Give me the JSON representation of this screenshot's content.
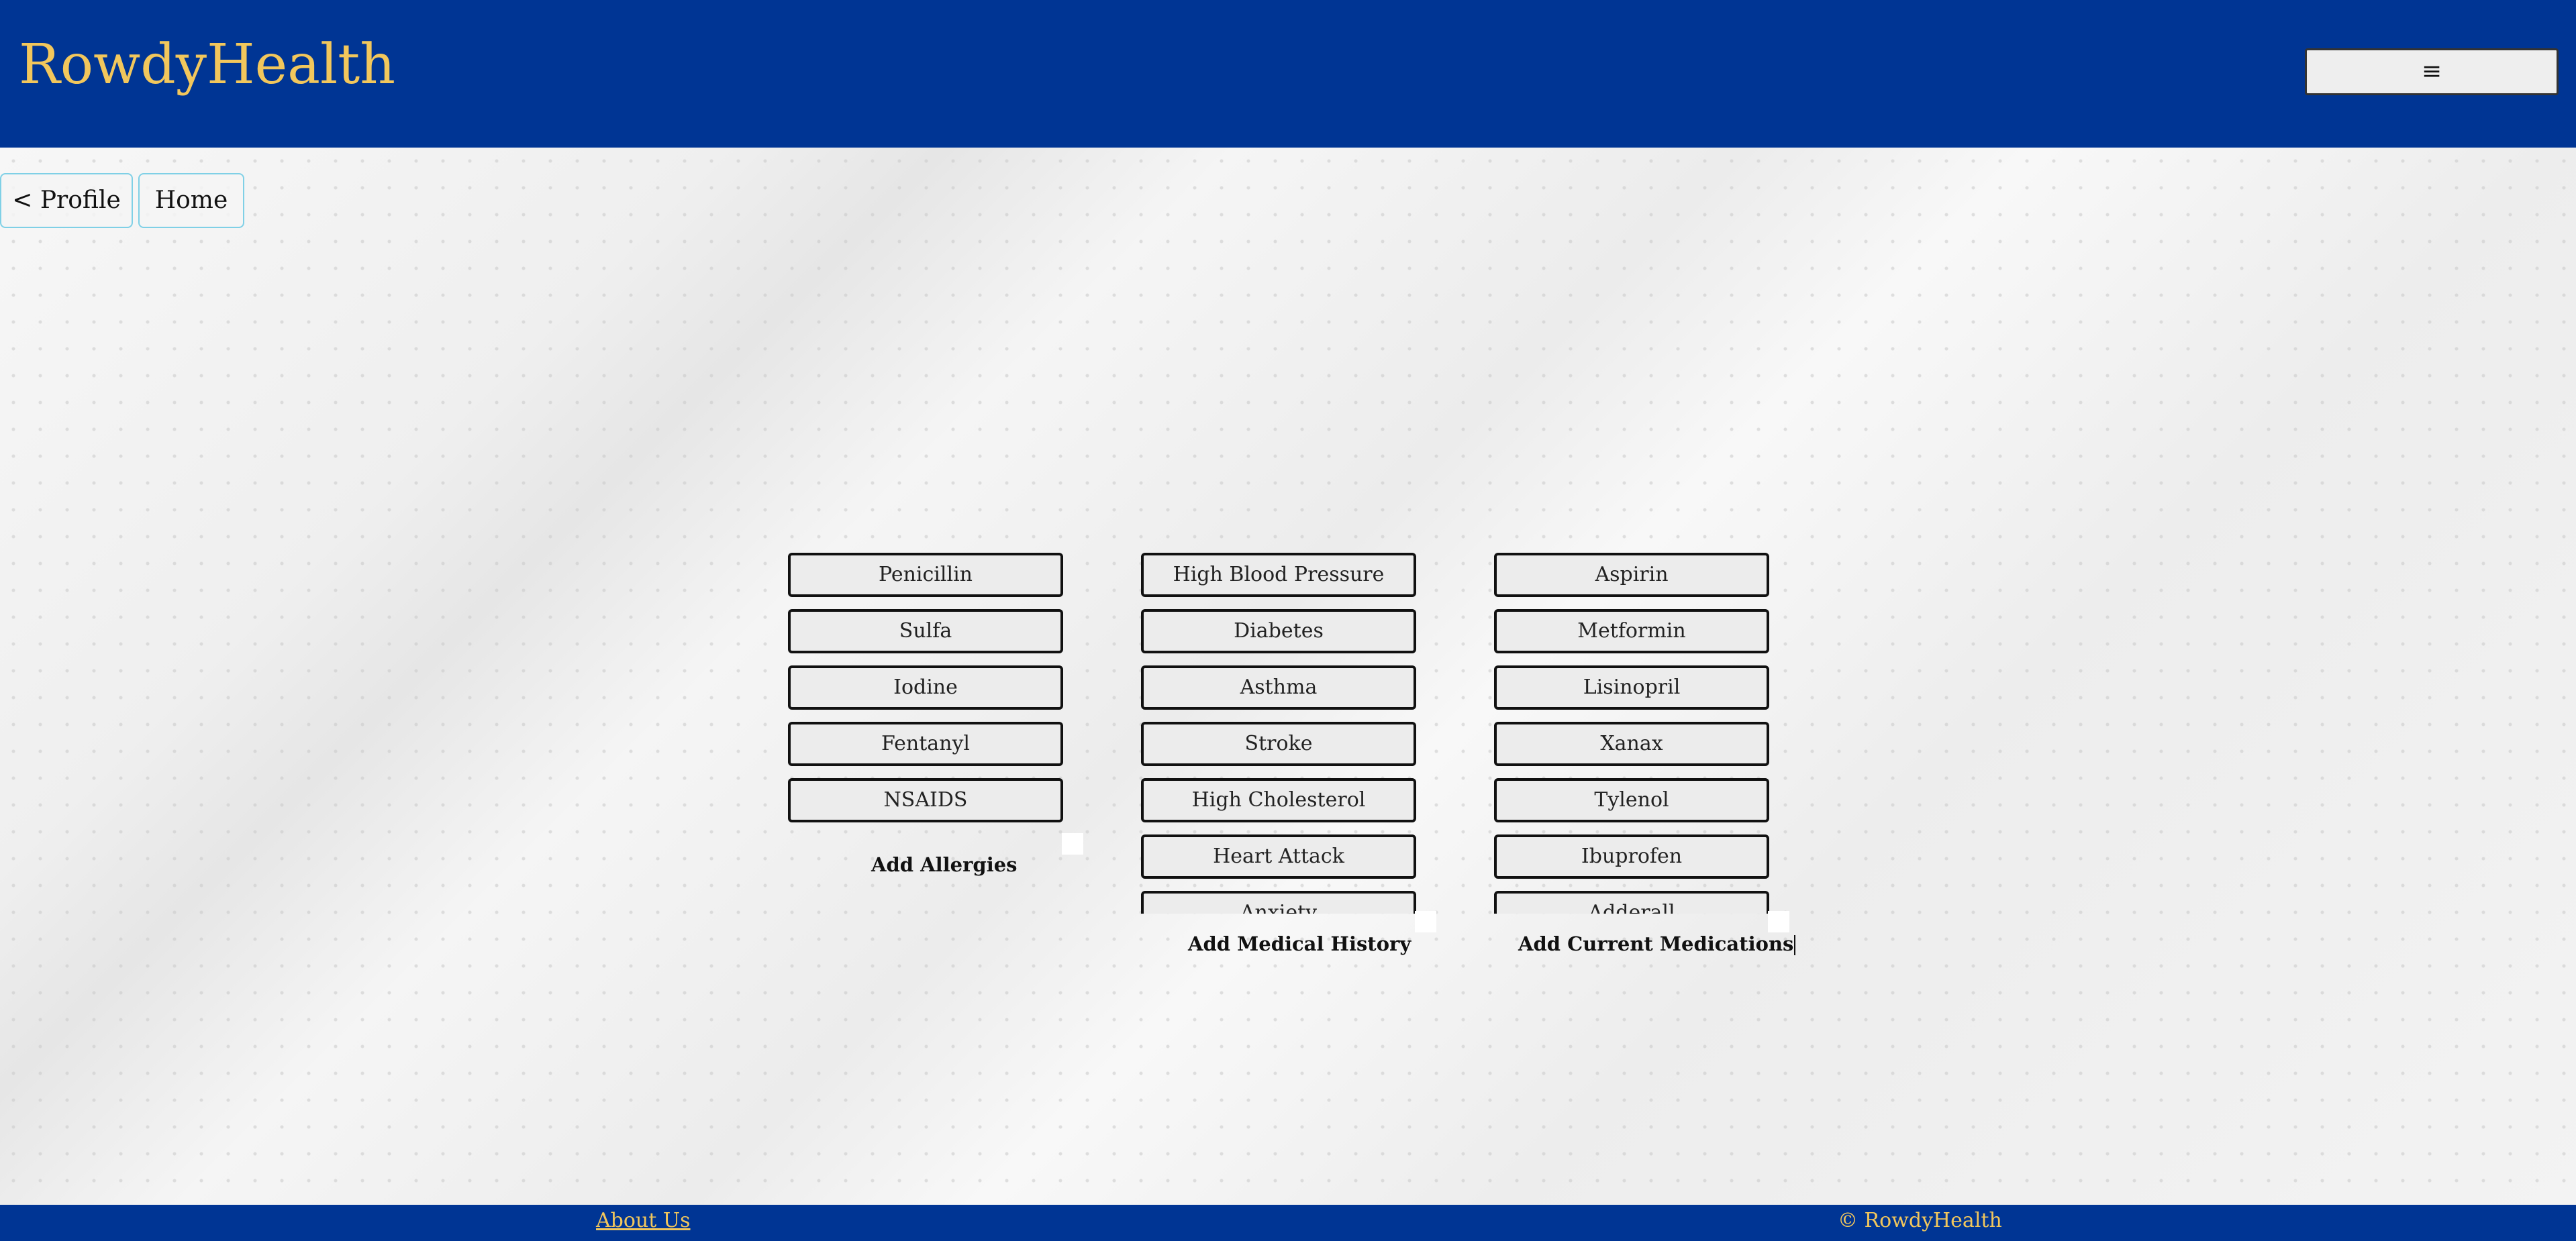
{
  "header": {
    "brand": "RowdyHealth",
    "menu_icon": "≡"
  },
  "nav": {
    "profile_label": "< Profile",
    "home_label": "Home"
  },
  "allergies": {
    "items": [
      "Penicillin",
      "Sulfa",
      "Iodine",
      "Fentanyl",
      "NSAIDS"
    ],
    "add_label": "Add Allergies"
  },
  "medical_history": {
    "items": [
      "High Blood Pressure",
      "Diabetes",
      "Asthma",
      "Stroke",
      "High Cholesterol",
      "Heart Attack",
      "Anxiety"
    ],
    "add_label": "Add Medical History"
  },
  "medications": {
    "items": [
      "Aspirin",
      "Metformin",
      "Lisinopril",
      "Xanax",
      "Tylenol",
      "Ibuprofen",
      "Adderall"
    ],
    "add_label": "Add Current Medications"
  },
  "footer": {
    "about_link": "About Us",
    "copyright": "© RowdyHealth"
  },
  "colors": {
    "brand_blue": "#003594",
    "brand_gold": "#f2c75c"
  }
}
